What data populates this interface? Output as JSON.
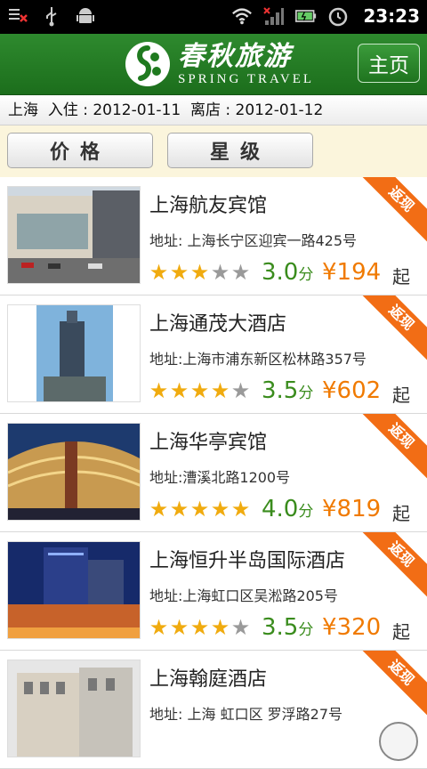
{
  "status_bar": {
    "time": "23:23",
    "icons": [
      "notification-icon",
      "usb-icon",
      "android-icon",
      "wifi-icon",
      "signal-icon",
      "battery-icon",
      "alarm-icon"
    ]
  },
  "header": {
    "logo_cn": "春秋旅游",
    "logo_en": "SPRING TRAVEL",
    "home_label": "主页",
    "brand_color": "#2a842a"
  },
  "search": {
    "city": "上海",
    "checkin_label": "入住 : ",
    "checkin": "2012-01-11",
    "checkout_label": "离店 : ",
    "checkout": "2012-01-12"
  },
  "sort": {
    "price_label": "价格",
    "star_label": "星级"
  },
  "hotels": [
    {
      "name": "上海航友宾馆",
      "address": "地址: 上海长宁区迎宾一路425号",
      "stars": 3,
      "score": "3.0",
      "score_unit": "分",
      "price": "¥194",
      "price_suffix": "起",
      "badge": "返现"
    },
    {
      "name": "上海通茂大酒店",
      "address": "地址:上海市浦东新区松林路357号",
      "stars": 4,
      "score": "3.5",
      "score_unit": "分",
      "price": "¥602",
      "price_suffix": "起",
      "badge": "返现"
    },
    {
      "name": "上海华亭宾馆",
      "address": "地址:漕溪北路1200号",
      "stars": 5,
      "score": "4.0",
      "score_unit": "分",
      "price": "¥819",
      "price_suffix": "起",
      "badge": "返现"
    },
    {
      "name": "上海恒升半岛国际酒店",
      "address": "地址:上海虹口区吴淞路205号",
      "stars": 4,
      "score": "3.5",
      "score_unit": "分",
      "price": "¥320",
      "price_suffix": "起",
      "badge": "返现"
    },
    {
      "name": "上海翰庭酒店",
      "address": "地址: 上海 虹口区 罗浮路27号",
      "stars": 0,
      "score": "",
      "score_unit": "",
      "price": "",
      "price_suffix": "",
      "badge": "返现"
    }
  ]
}
